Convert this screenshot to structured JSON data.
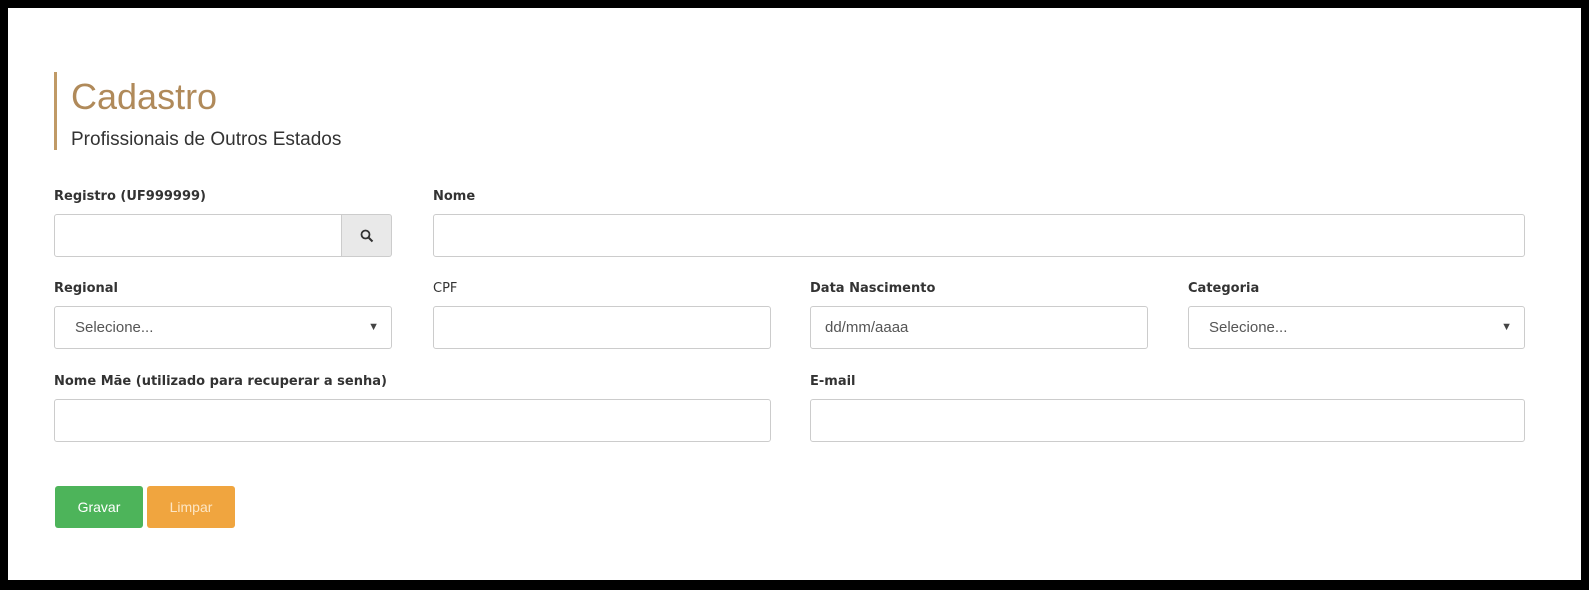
{
  "header": {
    "title": "Cadastro",
    "subtitle": "Profissionais de Outros Estados"
  },
  "fields": {
    "registro": {
      "label": "Registro (UF999999)",
      "value": ""
    },
    "nome": {
      "label": "Nome",
      "value": ""
    },
    "regional": {
      "label": "Regional",
      "selected": "Selecione..."
    },
    "cpf": {
      "label": "CPF",
      "value": ""
    },
    "data_nascimento": {
      "label": "Data Nascimento",
      "placeholder": "dd/mm/aaaa"
    },
    "categoria": {
      "label": "Categoria",
      "selected": "Selecione..."
    },
    "nome_mae": {
      "label": "Nome Mãe (utilizado para recuperar a senha)",
      "value": ""
    },
    "email": {
      "label": "E-mail",
      "value": ""
    }
  },
  "buttons": {
    "gravar": "Gravar",
    "limpar": "Limpar"
  },
  "colors": {
    "title": "#b08a5a",
    "accent_border": "#c09a66",
    "save": "#4db45a",
    "clear": "#f0a53f"
  },
  "icons": {
    "search": "search-icon",
    "dropdown": "caret-down-icon"
  }
}
